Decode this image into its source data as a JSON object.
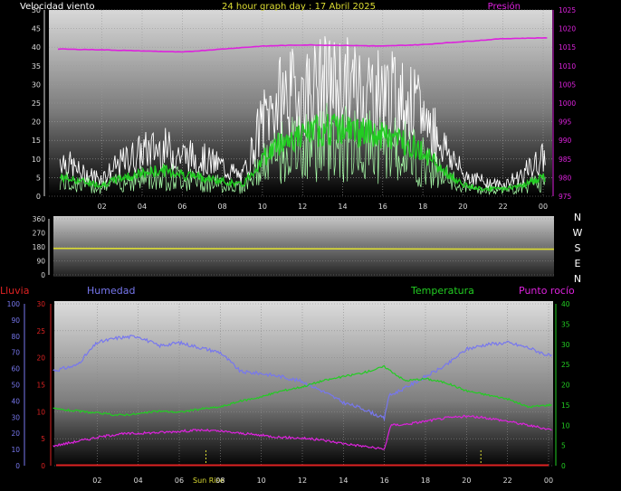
{
  "header": {
    "left_title": "Velocidad viento",
    "center_title": "24 hour graph day : 17 Abril 2025",
    "right_title": "Presión"
  },
  "wind_chart": {
    "type": "line",
    "x_ticks": [
      "02",
      "04",
      "06",
      "08",
      "10",
      "12",
      "14",
      "16",
      "18",
      "20",
      "22",
      "00"
    ],
    "y_ticks_left": [
      "0",
      "5",
      "10",
      "15",
      "20",
      "25",
      "30",
      "35",
      "40",
      "45",
      "50"
    ],
    "y_ticks_right": [
      "975",
      "980",
      "985",
      "990",
      "995",
      "1000",
      "1005",
      "1010",
      "1015",
      "1020",
      "1025"
    ],
    "ylim_left": [
      0,
      50
    ],
    "ylim_right": [
      975,
      1025
    ],
    "series": [
      {
        "key": "gust",
        "color": "#ffffff",
        "x": [
          0,
          1,
          2,
          3,
          4,
          5,
          6,
          7,
          8,
          9,
          10,
          11,
          12,
          13,
          14,
          15,
          16,
          17,
          18,
          19,
          20,
          21,
          22,
          23,
          24
        ],
        "y": [
          10,
          6,
          5,
          9,
          12,
          13,
          11,
          10,
          8,
          5,
          20,
          27,
          28,
          30,
          30,
          29,
          28,
          26,
          22,
          14,
          6,
          4,
          3,
          6,
          10
        ]
      },
      {
        "key": "avg",
        "color": "#22cc22",
        "x": [
          0,
          1,
          2,
          3,
          4,
          5,
          6,
          7,
          8,
          9,
          10,
          11,
          12,
          13,
          14,
          15,
          16,
          17,
          18,
          19,
          20,
          21,
          22,
          23,
          24
        ],
        "y": [
          5,
          4,
          3,
          5,
          6,
          7,
          6,
          5,
          4,
          3,
          10,
          15,
          16,
          18,
          18,
          17,
          16,
          15,
          12,
          7,
          3,
          2,
          2,
          3,
          5
        ]
      },
      {
        "key": "pressure",
        "color": "#dd22dd",
        "x": [
          0,
          2,
          4,
          6,
          8,
          10,
          12,
          14,
          16,
          18,
          20,
          22,
          24
        ],
        "y": [
          1014.5,
          1014.3,
          1014,
          1013.7,
          1014.5,
          1015.3,
          1015.6,
          1015.5,
          1015.3,
          1015.7,
          1016.5,
          1017.3,
          1017.5
        ]
      }
    ]
  },
  "direction_chart": {
    "type": "line",
    "x_ticks": [],
    "y_ticks": [
      "0",
      "90",
      "180",
      "270",
      "360"
    ],
    "ylim": [
      0,
      360
    ],
    "compass_labels": [
      "N",
      "W",
      "S",
      "E",
      "N"
    ],
    "series": [
      {
        "key": "direction",
        "color": "#dddd33",
        "x": [
          0,
          10.8,
          24
        ],
        "y": [
          170,
          168,
          165
        ]
      }
    ]
  },
  "legend": {
    "rain": "Lluvia",
    "humidity": "Humedad",
    "temperature": "Temperatura",
    "dewpoint": "Punto rocío"
  },
  "bottom_chart": {
    "type": "line",
    "x_ticks": [
      "02",
      "04",
      "06",
      "Sun Rise",
      "08",
      "10",
      "12",
      "14",
      "16",
      "18",
      "20",
      "22",
      "00"
    ],
    "y_ticks_humidity": [
      "0",
      "10",
      "20",
      "30",
      "40",
      "50",
      "60",
      "70",
      "80",
      "90",
      "100"
    ],
    "y_ticks_rain": [
      "0",
      "5",
      "10",
      "15",
      "20",
      "25",
      "30"
    ],
    "y_ticks_temp": [
      "0",
      "5",
      "10",
      "15",
      "20",
      "25",
      "30",
      "35",
      "40"
    ],
    "ylim_humidity": [
      0,
      100
    ],
    "ylim_rain": [
      0,
      30
    ],
    "ylim_temp": [
      0,
      40
    ],
    "series": [
      {
        "key": "humidity",
        "color": "#7777ee",
        "x": [
          0,
          1,
          2,
          3,
          4,
          5,
          6,
          7,
          8,
          9,
          10,
          11,
          12,
          13,
          14,
          15,
          16,
          16.2,
          17,
          18,
          19,
          20,
          21,
          22,
          23,
          24
        ],
        "y": [
          59,
          62,
          76,
          79,
          80,
          74,
          76,
          73,
          70,
          58,
          57,
          55,
          52,
          46,
          39,
          35,
          29,
          43,
          48,
          55,
          62,
          72,
          75,
          76,
          73,
          68
        ]
      },
      {
        "key": "temperature",
        "color": "#22cc22",
        "x": [
          0,
          1,
          2,
          3,
          4,
          5,
          6,
          7,
          8,
          9,
          10,
          11,
          12,
          13,
          14,
          15,
          16,
          17,
          18,
          19,
          20,
          21,
          22,
          23,
          24
        ],
        "y": [
          14,
          13.5,
          13,
          12.5,
          12.8,
          13.5,
          13.2,
          14,
          14.5,
          16,
          17,
          18.5,
          19.5,
          21,
          22,
          23,
          24.5,
          21,
          21.5,
          20.5,
          18.5,
          17.5,
          16.5,
          14.5,
          15
        ]
      },
      {
        "key": "dewpoint",
        "color": "#dd22dd",
        "x": [
          0,
          1,
          2,
          3,
          4,
          5,
          6,
          7,
          8,
          9,
          10,
          11,
          12,
          13,
          14,
          15,
          16,
          16.3,
          17,
          18,
          19,
          20,
          21,
          22,
          23,
          24
        ],
        "y": [
          5,
          6,
          7,
          7.8,
          8,
          8.2,
          8.5,
          8.8,
          8.5,
          8,
          7.5,
          7,
          6.8,
          6.3,
          5.5,
          4.8,
          4,
          10,
          10.2,
          11,
          11.8,
          12.2,
          11.8,
          11,
          10,
          9
        ]
      },
      {
        "key": "rain",
        "color": "#dd2222",
        "x": [
          0,
          24
        ],
        "y": [
          0,
          0
        ]
      }
    ],
    "markers": [
      {
        "key": "sunrise",
        "x": 7.3,
        "color": "#dddd33"
      },
      {
        "key": "sunset",
        "x": 20.7,
        "color": "#dddd33"
      }
    ]
  }
}
